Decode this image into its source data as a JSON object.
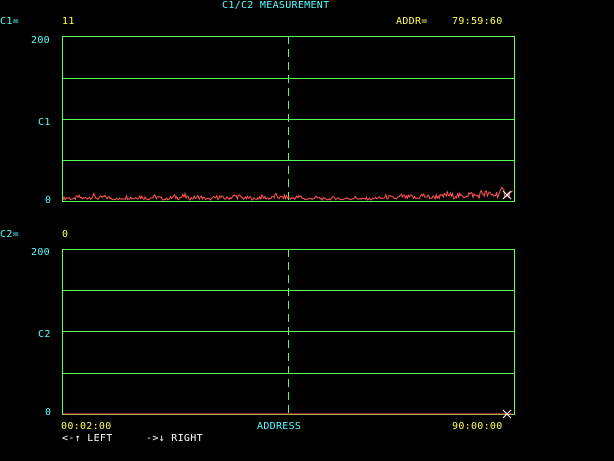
{
  "header": {
    "title": "C1/C2 MEASUREMENT",
    "c1_label": "C1=",
    "c1_value": "11",
    "addr_label": "ADDR=",
    "addr_value": "79:59:60"
  },
  "chart1": {
    "y_max_label": "200",
    "y_mid_label": "C1",
    "y_min_label": "0"
  },
  "c2_row": {
    "c2_label": "C2=",
    "c2_value": "0"
  },
  "chart2": {
    "y_max_label": "200",
    "y_mid_label": "C2",
    "y_min_label": "0"
  },
  "x_axis": {
    "start_label": "00:02:00",
    "center_label": "ADDRESS",
    "end_label": "90:00:00"
  },
  "nav_hint": {
    "left": "<-↑ LEFT",
    "right": "->↓ RIGHT"
  },
  "colors": {
    "grid": "#55ff55",
    "trace": "#ff5555",
    "label": "#55ffff",
    "value": "#ffff55",
    "background": "#000000"
  },
  "chart_data": [
    {
      "type": "line",
      "series": [
        {
          "values": [
            3,
            4,
            2,
            5,
            3,
            4,
            6,
            3,
            5,
            4,
            3,
            2,
            4,
            5,
            3,
            6,
            4,
            3,
            5,
            4,
            2,
            3,
            5,
            4,
            6,
            3,
            4,
            5,
            3,
            2,
            4,
            5,
            3,
            4,
            6,
            5,
            3,
            4,
            2,
            5,
            4,
            3,
            6,
            4,
            5,
            3,
            4,
            5,
            2,
            3,
            4,
            3,
            2,
            3,
            4,
            2,
            3,
            3,
            4,
            2,
            3,
            2,
            4,
            3,
            5,
            4,
            3,
            6,
            4,
            5,
            3,
            7,
            5,
            4,
            6,
            5,
            8,
            6,
            7,
            5,
            9,
            7,
            6,
            10,
            8,
            7,
            9,
            11,
            8,
            10
          ]
        }
      ],
      "ylim": [
        0,
        200
      ]
    },
    {
      "type": "line",
      "series": [
        {
          "values": [
            0,
            0
          ]
        }
      ],
      "ylim": [
        0,
        200
      ]
    }
  ]
}
